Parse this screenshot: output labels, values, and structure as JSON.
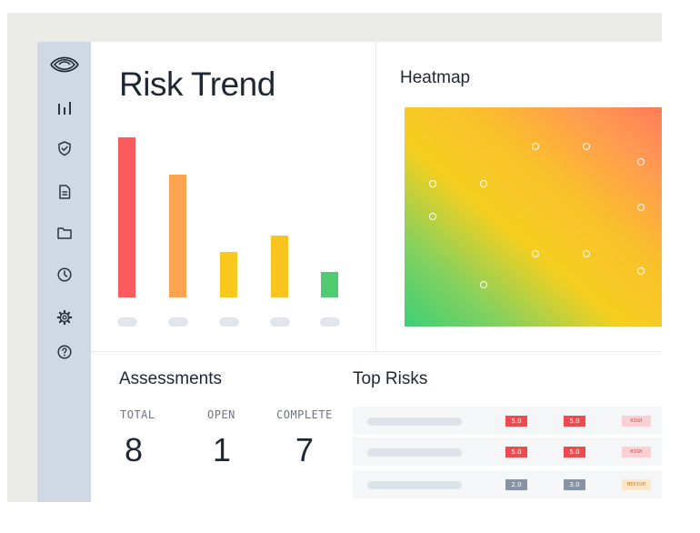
{
  "sidebar": {
    "items": [
      {
        "icon": "eye-logo-icon"
      },
      {
        "icon": "bar-chart-icon"
      },
      {
        "icon": "shield-check-icon"
      },
      {
        "icon": "document-icon"
      },
      {
        "icon": "folder-icon"
      },
      {
        "icon": "clock-icon"
      },
      {
        "icon": "gear-icon"
      },
      {
        "icon": "help-icon"
      }
    ]
  },
  "risk_trend": {
    "title": "Risk Trend",
    "chart_data": {
      "type": "bar",
      "title": "Risk Trend",
      "categories": [
        "",
        "",
        "",
        "",
        ""
      ],
      "values": [
        100,
        76.7,
        28.4,
        38.6,
        15.9
      ],
      "colors": [
        "#fa5b5c",
        "#fda450",
        "#f8c91c",
        "#f9c41e",
        "#4fcc72"
      ],
      "ylim": [
        0,
        100
      ]
    }
  },
  "heatmap": {
    "title": "Heatmap",
    "colors": {
      "low": "#3ecf76",
      "mid": "#f4cf20",
      "high": "#ff7c58"
    },
    "points": [
      {
        "x": 0.51,
        "y": 0.82
      },
      {
        "x": 0.71,
        "y": 0.82
      },
      {
        "x": 0.92,
        "y": 0.75
      },
      {
        "x": 0.11,
        "y": 0.65
      },
      {
        "x": 0.31,
        "y": 0.65
      },
      {
        "x": 0.11,
        "y": 0.5
      },
      {
        "x": 0.92,
        "y": 0.54
      },
      {
        "x": 0.51,
        "y": 0.33
      },
      {
        "x": 0.71,
        "y": 0.33
      },
      {
        "x": 0.92,
        "y": 0.25
      },
      {
        "x": 0.31,
        "y": 0.19
      }
    ]
  },
  "assessments": {
    "title": "Assessments",
    "stats": [
      {
        "label": "TOTAL",
        "value": "8"
      },
      {
        "label": "OPEN",
        "value": "1"
      },
      {
        "label": "COMPLETE",
        "value": "7"
      }
    ]
  },
  "top_risks": {
    "title": "Top Risks",
    "rows": [
      {
        "score1": "5.0",
        "score2": "5.0",
        "level": "HIGH",
        "score_color": "#ef4a4f",
        "level_bg": "#fcd0d2",
        "level_fg": "#d53f43"
      },
      {
        "score1": "5.0",
        "score2": "5.0",
        "level": "HIGH",
        "score_color": "#ef4a4f",
        "level_bg": "#fcd0d2",
        "level_fg": "#d53f43"
      },
      {
        "score1": "2.0",
        "score2": "3.0",
        "level": "MEDIUM",
        "score_color": "#8792a2",
        "level_bg": "#fde7c6",
        "level_fg": "#c97a1c"
      }
    ]
  }
}
